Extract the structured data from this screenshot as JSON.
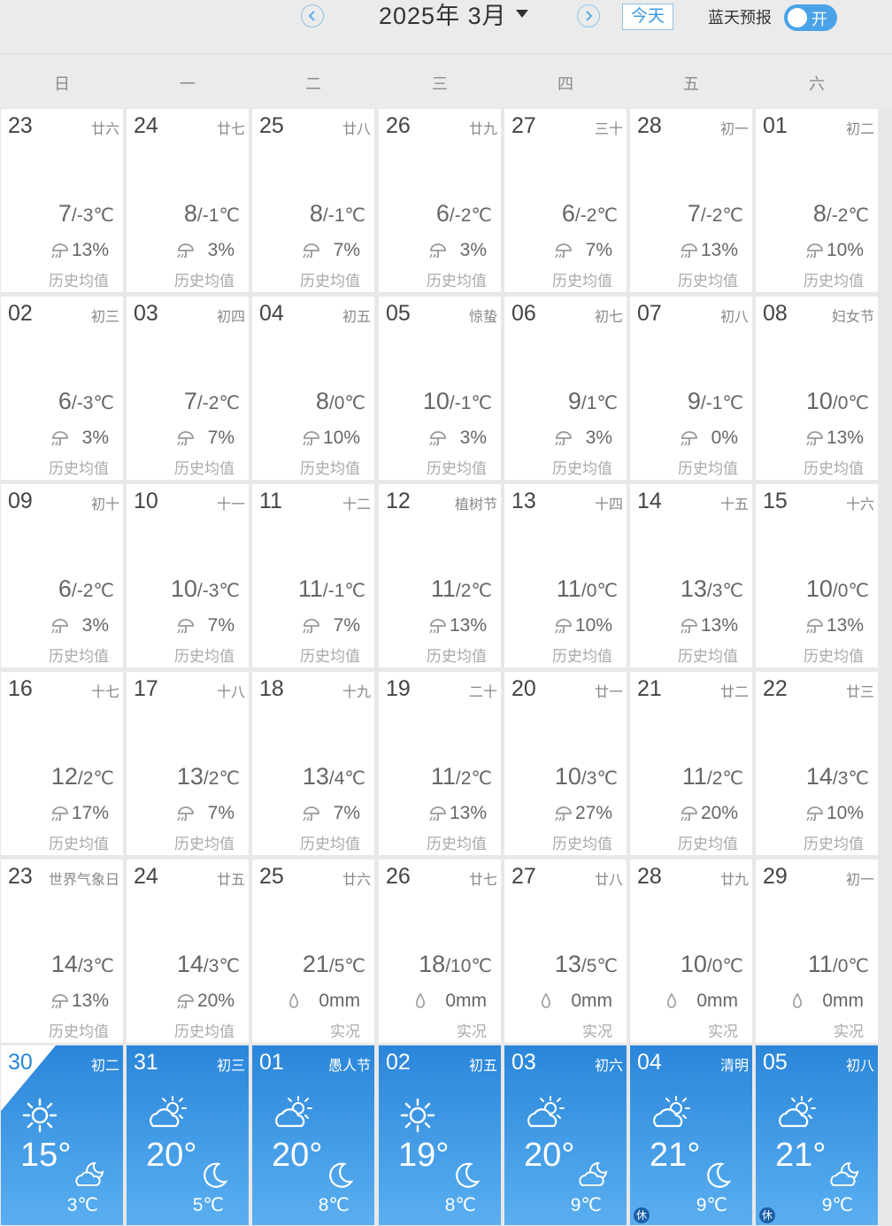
{
  "header": {
    "month_label": "2025年 3月",
    "today_label": "今天",
    "bluesky_label": "蓝天预报",
    "toggle_label": "开"
  },
  "weekdays": [
    "日",
    "一",
    "二",
    "三",
    "四",
    "五",
    "六"
  ],
  "grid": [
    [
      {
        "day": "23",
        "lunar": "廿六",
        "hi": "7",
        "lo": "-3℃",
        "rain": "13%",
        "note": "历史均值"
      },
      {
        "day": "24",
        "lunar": "廿七",
        "hi": "8",
        "lo": "-1℃",
        "rain": "3%",
        "note": "历史均值"
      },
      {
        "day": "25",
        "lunar": "廿八",
        "hi": "8",
        "lo": "-1℃",
        "rain": "7%",
        "note": "历史均值"
      },
      {
        "day": "26",
        "lunar": "廿九",
        "hi": "6",
        "lo": "-2℃",
        "rain": "3%",
        "note": "历史均值"
      },
      {
        "day": "27",
        "lunar": "三十",
        "hi": "6",
        "lo": "-2℃",
        "rain": "7%",
        "note": "历史均值"
      },
      {
        "day": "28",
        "lunar": "初一",
        "hi": "7",
        "lo": "-2℃",
        "rain": "13%",
        "note": "历史均值"
      },
      {
        "day": "01",
        "lunar": "初二",
        "hi": "8",
        "lo": "-2℃",
        "rain": "10%",
        "note": "历史均值"
      }
    ],
    [
      {
        "day": "02",
        "lunar": "初三",
        "hi": "6",
        "lo": "-3℃",
        "rain": "3%",
        "note": "历史均值"
      },
      {
        "day": "03",
        "lunar": "初四",
        "hi": "7",
        "lo": "-2℃",
        "rain": "7%",
        "note": "历史均值"
      },
      {
        "day": "04",
        "lunar": "初五",
        "hi": "8",
        "lo": "0℃",
        "rain": "10%",
        "note": "历史均值"
      },
      {
        "day": "05",
        "lunar": "惊蛰",
        "hi": "10",
        "lo": "-1℃",
        "rain": "3%",
        "note": "历史均值"
      },
      {
        "day": "06",
        "lunar": "初七",
        "hi": "9",
        "lo": "1℃",
        "rain": "3%",
        "note": "历史均值"
      },
      {
        "day": "07",
        "lunar": "初八",
        "hi": "9",
        "lo": "-1℃",
        "rain": "0%",
        "note": "历史均值"
      },
      {
        "day": "08",
        "lunar": "妇女节",
        "hi": "10",
        "lo": "0℃",
        "rain": "13%",
        "note": "历史均值"
      }
    ],
    [
      {
        "day": "09",
        "lunar": "初十",
        "hi": "6",
        "lo": "-2℃",
        "rain": "3%",
        "note": "历史均值"
      },
      {
        "day": "10",
        "lunar": "十一",
        "hi": "10",
        "lo": "-3℃",
        "rain": "7%",
        "note": "历史均值"
      },
      {
        "day": "11",
        "lunar": "十二",
        "hi": "11",
        "lo": "-1℃",
        "rain": "7%",
        "note": "历史均值"
      },
      {
        "day": "12",
        "lunar": "植树节",
        "hi": "11",
        "lo": "2℃",
        "rain": "13%",
        "note": "历史均值"
      },
      {
        "day": "13",
        "lunar": "十四",
        "hi": "11",
        "lo": "0℃",
        "rain": "10%",
        "note": "历史均值"
      },
      {
        "day": "14",
        "lunar": "十五",
        "hi": "13",
        "lo": "3℃",
        "rain": "13%",
        "note": "历史均值"
      },
      {
        "day": "15",
        "lunar": "十六",
        "hi": "10",
        "lo": "0℃",
        "rain": "13%",
        "note": "历史均值"
      }
    ],
    [
      {
        "day": "16",
        "lunar": "十七",
        "hi": "12",
        "lo": "2℃",
        "rain": "17%",
        "note": "历史均值"
      },
      {
        "day": "17",
        "lunar": "十八",
        "hi": "13",
        "lo": "2℃",
        "rain": "7%",
        "note": "历史均值"
      },
      {
        "day": "18",
        "lunar": "十九",
        "hi": "13",
        "lo": "4℃",
        "rain": "7%",
        "note": "历史均值"
      },
      {
        "day": "19",
        "lunar": "二十",
        "hi": "11",
        "lo": "2℃",
        "rain": "13%",
        "note": "历史均值"
      },
      {
        "day": "20",
        "lunar": "廿一",
        "hi": "10",
        "lo": "3℃",
        "rain": "27%",
        "note": "历史均值"
      },
      {
        "day": "21",
        "lunar": "廿二",
        "hi": "11",
        "lo": "2℃",
        "rain": "20%",
        "note": "历史均值"
      },
      {
        "day": "22",
        "lunar": "廿三",
        "hi": "14",
        "lo": "3℃",
        "rain": "10%",
        "note": "历史均值"
      }
    ],
    [
      {
        "day": "23",
        "lunar": "世界气象日",
        "hi": "14",
        "lo": "3℃",
        "rain": "13%",
        "note": "历史均值"
      },
      {
        "day": "24",
        "lunar": "廿五",
        "hi": "14",
        "lo": "3℃",
        "rain": "20%",
        "note": "历史均值"
      },
      {
        "day": "25",
        "lunar": "廿六",
        "hi": "21",
        "lo": "5℃",
        "rain": "0mm",
        "note": "实况",
        "actual": true
      },
      {
        "day": "26",
        "lunar": "廿七",
        "hi": "18",
        "lo": "10℃",
        "rain": "0mm",
        "note": "实况",
        "actual": true
      },
      {
        "day": "27",
        "lunar": "廿八",
        "hi": "13",
        "lo": "5℃",
        "rain": "0mm",
        "note": "实况",
        "actual": true
      },
      {
        "day": "28",
        "lunar": "廿九",
        "hi": "10",
        "lo": "0℃",
        "rain": "0mm",
        "note": "实况",
        "actual": true
      },
      {
        "day": "29",
        "lunar": "初一",
        "hi": "11",
        "lo": "0℃",
        "rain": "0mm",
        "note": "实况",
        "actual": true
      }
    ]
  ],
  "forecast": [
    {
      "day": "30",
      "lunar": "初二",
      "hi": "15°",
      "lo": "3℃",
      "icon": "sunny-icon",
      "night": "partly-cloudy-night-icon",
      "today": true
    },
    {
      "day": "31",
      "lunar": "初三",
      "hi": "20°",
      "lo": "5℃",
      "icon": "partly-cloudy-icon",
      "night": "clear-night-icon"
    },
    {
      "day": "01",
      "lunar": "愚人节",
      "hi": "20°",
      "lo": "8℃",
      "icon": "partly-cloudy-icon",
      "night": "clear-night-icon"
    },
    {
      "day": "02",
      "lunar": "初五",
      "hi": "19°",
      "lo": "8℃",
      "icon": "sunny-icon",
      "night": "clear-night-icon"
    },
    {
      "day": "03",
      "lunar": "初六",
      "hi": "20°",
      "lo": "9℃",
      "icon": "partly-cloudy-icon",
      "night": "partly-cloudy-night-icon"
    },
    {
      "day": "04",
      "lunar": "清明",
      "hi": "21°",
      "lo": "9℃",
      "icon": "partly-cloudy-icon",
      "night": "clear-night-icon",
      "rest": "休"
    },
    {
      "day": "05",
      "lunar": "初八",
      "hi": "21°",
      "lo": "9℃",
      "icon": "partly-cloudy-icon",
      "night": "partly-cloudy-night-icon",
      "rest": "休"
    }
  ]
}
